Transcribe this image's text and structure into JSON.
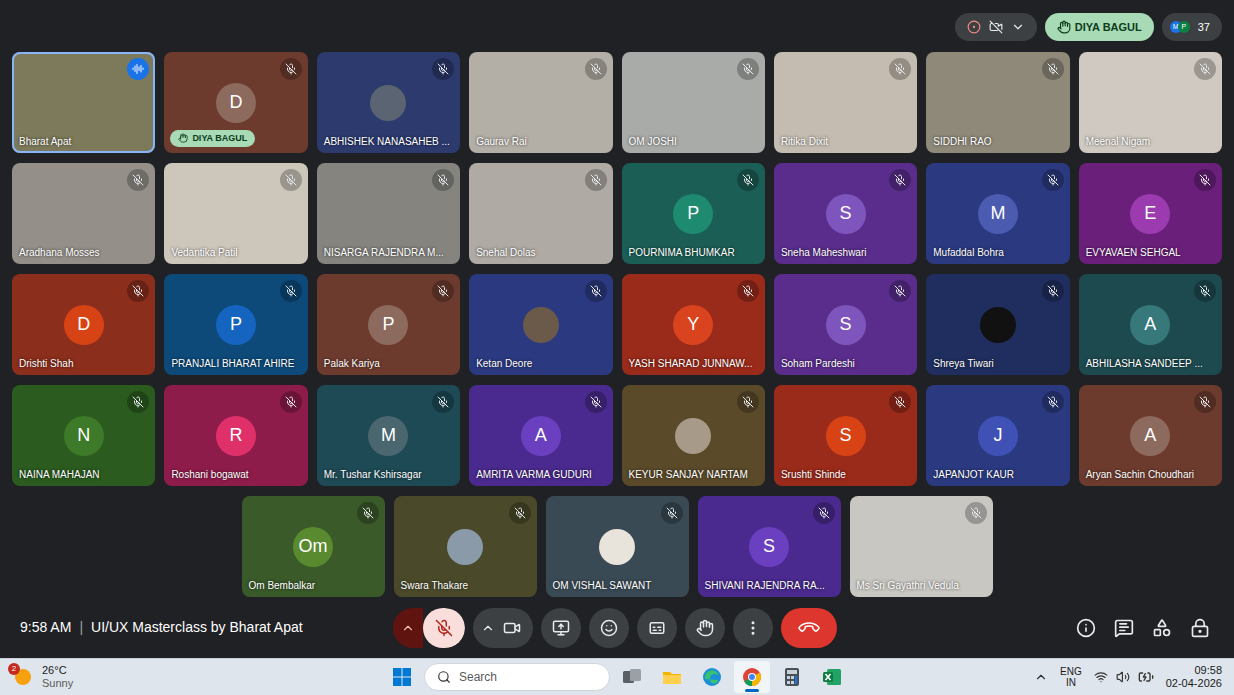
{
  "toolbar": {
    "recording": true,
    "raised_hand": {
      "label": "DIYA BAGUL"
    },
    "participants": {
      "count": "37",
      "avatars": [
        {
          "letter": "M",
          "color": "#1a73e8"
        },
        {
          "letter": "P",
          "color": "#0b8043"
        }
      ]
    }
  },
  "tile_rows": [
    [
      {
        "name": "Bharat Apat",
        "kind": "video",
        "color": "#7c7a5a",
        "muted": false,
        "speaking": true,
        "hand_raised": false
      },
      {
        "name": "DIYA BAGUL",
        "kind": "avatar",
        "letter": "D",
        "color": "#6d3b2e",
        "avatar_color": "#8d6a5e",
        "muted": true,
        "speaking": false,
        "hand_raised": true
      },
      {
        "name": "ABHISHEK NANASAHEB ...",
        "kind": "picture",
        "color": "#2c3a6e",
        "avatar_color": "#5a6472",
        "muted": true,
        "speaking": false,
        "hand_raised": false
      },
      {
        "name": "Gaurav Rai",
        "kind": "video",
        "color": "#b3aea6",
        "muted": true,
        "speaking": false,
        "hand_raised": false
      },
      {
        "name": "OM JOSHI",
        "kind": "video",
        "color": "#a9aba8",
        "muted": true,
        "speaking": false,
        "hand_raised": false
      },
      {
        "name": "Ritika Dixit",
        "kind": "video",
        "color": "#c4bcb1",
        "muted": true,
        "speaking": false,
        "hand_raised": false
      },
      {
        "name": "SIDDHI RAO",
        "kind": "video",
        "color": "#8f897a",
        "muted": true,
        "speaking": false,
        "hand_raised": false
      },
      {
        "name": "Meenal Nigam",
        "kind": "video",
        "color": "#cfc9c1",
        "muted": true,
        "speaking": false,
        "hand_raised": false
      }
    ],
    [
      {
        "name": "Aradhana Mosses",
        "kind": "video",
        "color": "#948f88",
        "muted": true,
        "speaking": false,
        "hand_raised": false
      },
      {
        "name": "Vedantika Patil",
        "kind": "video",
        "color": "#cdc6bb",
        "muted": true,
        "speaking": false,
        "hand_raised": false
      },
      {
        "name": "NISARGA RAJENDRA M...",
        "kind": "video",
        "color": "#85847f",
        "muted": true,
        "speaking": false,
        "hand_raised": false
      },
      {
        "name": "Snehal Dolas",
        "kind": "video",
        "color": "#afaaa3",
        "muted": true,
        "speaking": false,
        "hand_raised": false
      },
      {
        "name": "POURNIMA BHUMKAR",
        "kind": "avatar",
        "letter": "P",
        "color": "#1b5e55",
        "avatar_color": "#1e8a6f",
        "muted": true,
        "speaking": false,
        "hand_raised": false
      },
      {
        "name": "Sneha Maheshwari",
        "kind": "avatar",
        "letter": "S",
        "color": "#5a2d8c",
        "avatar_color": "#7e55bd",
        "muted": true,
        "speaking": false,
        "hand_raised": false
      },
      {
        "name": "Mufaddal Bohra",
        "kind": "avatar",
        "letter": "M",
        "color": "#2b3a80",
        "avatar_color": "#4a5bb0",
        "muted": true,
        "speaking": false,
        "hand_raised": false
      },
      {
        "name": "EVYAVAEN SEHGAL",
        "kind": "avatar",
        "letter": "E",
        "color": "#6a1f7a",
        "avatar_color": "#9c3bb0",
        "muted": true,
        "speaking": false,
        "hand_raised": false
      }
    ],
    [
      {
        "name": "Drishti Shah",
        "kind": "avatar",
        "letter": "D",
        "color": "#8b2e1c",
        "avatar_color": "#d84315",
        "muted": true,
        "speaking": false,
        "hand_raised": false
      },
      {
        "name": "PRANJALI BHARAT AHIRE",
        "kind": "avatar",
        "letter": "P",
        "color": "#0d4a7a",
        "avatar_color": "#1565c0",
        "muted": true,
        "speaking": false,
        "hand_raised": false
      },
      {
        "name": "Palak Kariya",
        "kind": "avatar",
        "letter": "P",
        "color": "#6d3b2e",
        "avatar_color": "#8d6a5e",
        "muted": true,
        "speaking": false,
        "hand_raised": false
      },
      {
        "name": "Ketan Deore",
        "kind": "picture",
        "color": "#2b3a80",
        "avatar_color": "#6b5a4a",
        "muted": true,
        "speaking": false,
        "hand_raised": false
      },
      {
        "name": "YASH SHARAD JUNNAW...",
        "kind": "avatar",
        "letter": "Y",
        "color": "#9a2a1a",
        "avatar_color": "#d9441e",
        "muted": true,
        "speaking": false,
        "hand_raised": false
      },
      {
        "name": "Soham Pardeshi",
        "kind": "avatar",
        "letter": "S",
        "color": "#5a2d8c",
        "avatar_color": "#7e55bd",
        "muted": true,
        "speaking": false,
        "hand_raised": false
      },
      {
        "name": "Shreya Tiwari",
        "kind": "picture",
        "color": "#1f2e5e",
        "avatar_color": "#111111",
        "muted": true,
        "speaking": false,
        "hand_raised": false
      },
      {
        "name": "ABHILASHA SANDEEP ...",
        "kind": "avatar",
        "letter": "A",
        "color": "#1d4a4f",
        "avatar_color": "#37787b",
        "muted": true,
        "speaking": false,
        "hand_raised": false
      }
    ],
    [
      {
        "name": "NAINA MAHAJAN",
        "kind": "avatar",
        "letter": "N",
        "color": "#2b5b1f",
        "avatar_color": "#3d7a2a",
        "muted": true,
        "speaking": false,
        "hand_raised": false
      },
      {
        "name": "Roshani bogawat",
        "kind": "avatar",
        "letter": "R",
        "color": "#8e1c4a",
        "avatar_color": "#e0306a",
        "muted": true,
        "speaking": false,
        "hand_raised": false
      },
      {
        "name": "Mr. Tushar Kshirsagar",
        "kind": "avatar",
        "letter": "M",
        "color": "#1d4a55",
        "avatar_color": "#4a6770",
        "muted": true,
        "speaking": false,
        "hand_raised": false
      },
      {
        "name": "AMRITA VARMA GUDURI",
        "kind": "avatar",
        "letter": "A",
        "color": "#4a2a8e",
        "avatar_color": "#6a3fc0",
        "muted": true,
        "speaking": false,
        "hand_raised": false
      },
      {
        "name": "KEYUR SANJAY NARTAM",
        "kind": "picture",
        "color": "#5a4a2a",
        "avatar_color": "#a89a88",
        "muted": true,
        "speaking": false,
        "hand_raised": false
      },
      {
        "name": "Srushti Shinde",
        "kind": "avatar",
        "letter": "S",
        "color": "#9a2a1a",
        "avatar_color": "#d84315",
        "muted": true,
        "speaking": false,
        "hand_raised": false
      },
      {
        "name": "JAPANJOT KAUR",
        "kind": "avatar",
        "letter": "J",
        "color": "#2b3a80",
        "avatar_color": "#3f51b5",
        "muted": true,
        "speaking": false,
        "hand_raised": false
      },
      {
        "name": "Aryan Sachin Choudhari",
        "kind": "avatar",
        "letter": "A",
        "color": "#6d3b2e",
        "avatar_color": "#8d6a5e",
        "muted": true,
        "speaking": false,
        "hand_raised": false
      }
    ],
    [
      {
        "name": "Om Bembalkar",
        "kind": "avatar",
        "letter": "Om",
        "color": "#3a5a2a",
        "avatar_color": "#5a8a2f",
        "muted": true,
        "speaking": false,
        "hand_raised": false
      },
      {
        "name": "Swara Thakare",
        "kind": "picture",
        "color": "#4a4a2a",
        "avatar_color": "#8a9aa8",
        "muted": true,
        "speaking": false,
        "hand_raised": false
      },
      {
        "name": "OM VISHAL SAWANT",
        "kind": "picture",
        "color": "#3a4a55",
        "avatar_color": "#e8e4dc",
        "muted": true,
        "speaking": false,
        "hand_raised": false
      },
      {
        "name": "SHIVANI RAJENDRA RA...",
        "kind": "avatar",
        "letter": "S",
        "color": "#4a2a8e",
        "avatar_color": "#6a3fc0",
        "muted": true,
        "speaking": false,
        "hand_raised": false
      },
      {
        "name": "Ms Sri Gayathri Vedula",
        "kind": "video",
        "color": "#c9c7c2",
        "muted": true,
        "speaking": false,
        "hand_raised": false
      }
    ]
  ],
  "meeting": {
    "time": "9:58 AM",
    "separator": "|",
    "title": "UI/UX Masterclass by Bharat Apat"
  },
  "controls": {
    "mic": {
      "on": false
    },
    "camera": {
      "on": true
    }
  },
  "taskbar": {
    "weather": {
      "badge": "2",
      "temp": "26°C",
      "condition": "Sunny"
    },
    "search": {
      "placeholder": "Search"
    },
    "apps": [
      {
        "kind": "taskview",
        "active": false
      },
      {
        "kind": "folder",
        "active": false
      },
      {
        "kind": "edge",
        "active": false
      },
      {
        "kind": "chrome",
        "active": true
      },
      {
        "kind": "calculator",
        "active": false
      },
      {
        "kind": "excel",
        "active": false
      }
    ],
    "language": {
      "line1": "ENG",
      "line2": "IN"
    },
    "clock": {
      "time": "09:58",
      "date": "02-04-2026"
    }
  }
}
